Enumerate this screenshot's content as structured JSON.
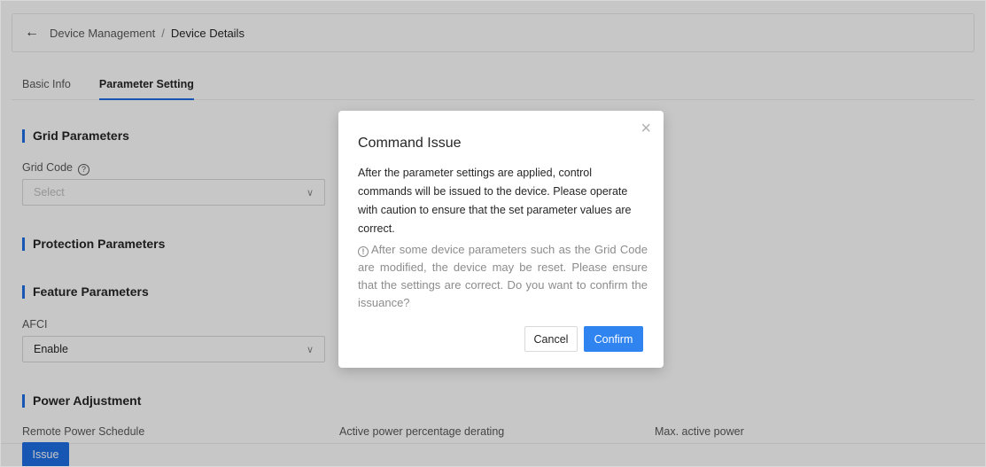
{
  "breadcrumb": {
    "back_icon": "arrow-left-icon",
    "parent": "Device Management",
    "separator": "/",
    "current": "Device Details"
  },
  "tabs": [
    {
      "label": "Basic Info",
      "active": false
    },
    {
      "label": "Parameter Setting",
      "active": true
    }
  ],
  "sections": {
    "grid": {
      "title": "Grid Parameters",
      "grid_code_label": "Grid Code",
      "grid_code_help_icon": "question-circle-icon",
      "grid_code_placeholder": "Select"
    },
    "protection": {
      "title": "Protection Parameters"
    },
    "feature": {
      "title": "Feature Parameters",
      "afci_label": "AFCI",
      "afci_value": "Enable"
    },
    "power": {
      "title": "Power Adjustment",
      "remote_schedule_label": "Remote Power Schedule",
      "active_derating_label": "Active power percentage derating",
      "max_active_label": "Max. active power"
    }
  },
  "footer": {
    "issue_label": "Issue"
  },
  "modal": {
    "title": "Command Issue",
    "close_icon": "close-icon",
    "body": "After the parameter settings are applied, control commands will be issued to the device. Please operate with caution to ensure that the set parameter values are correct.",
    "info_icon": "info-circle-icon",
    "note": "After some device parameters such as the Grid Code are modified, the device may be reset. Please ensure that the settings are correct. Do you want to confirm the issuance?",
    "cancel_label": "Cancel",
    "confirm_label": "Confirm"
  },
  "colors": {
    "primary": "#1e6fe6",
    "confirm": "#2f84f0",
    "overlay": "rgba(0,0,0,0.22)"
  }
}
